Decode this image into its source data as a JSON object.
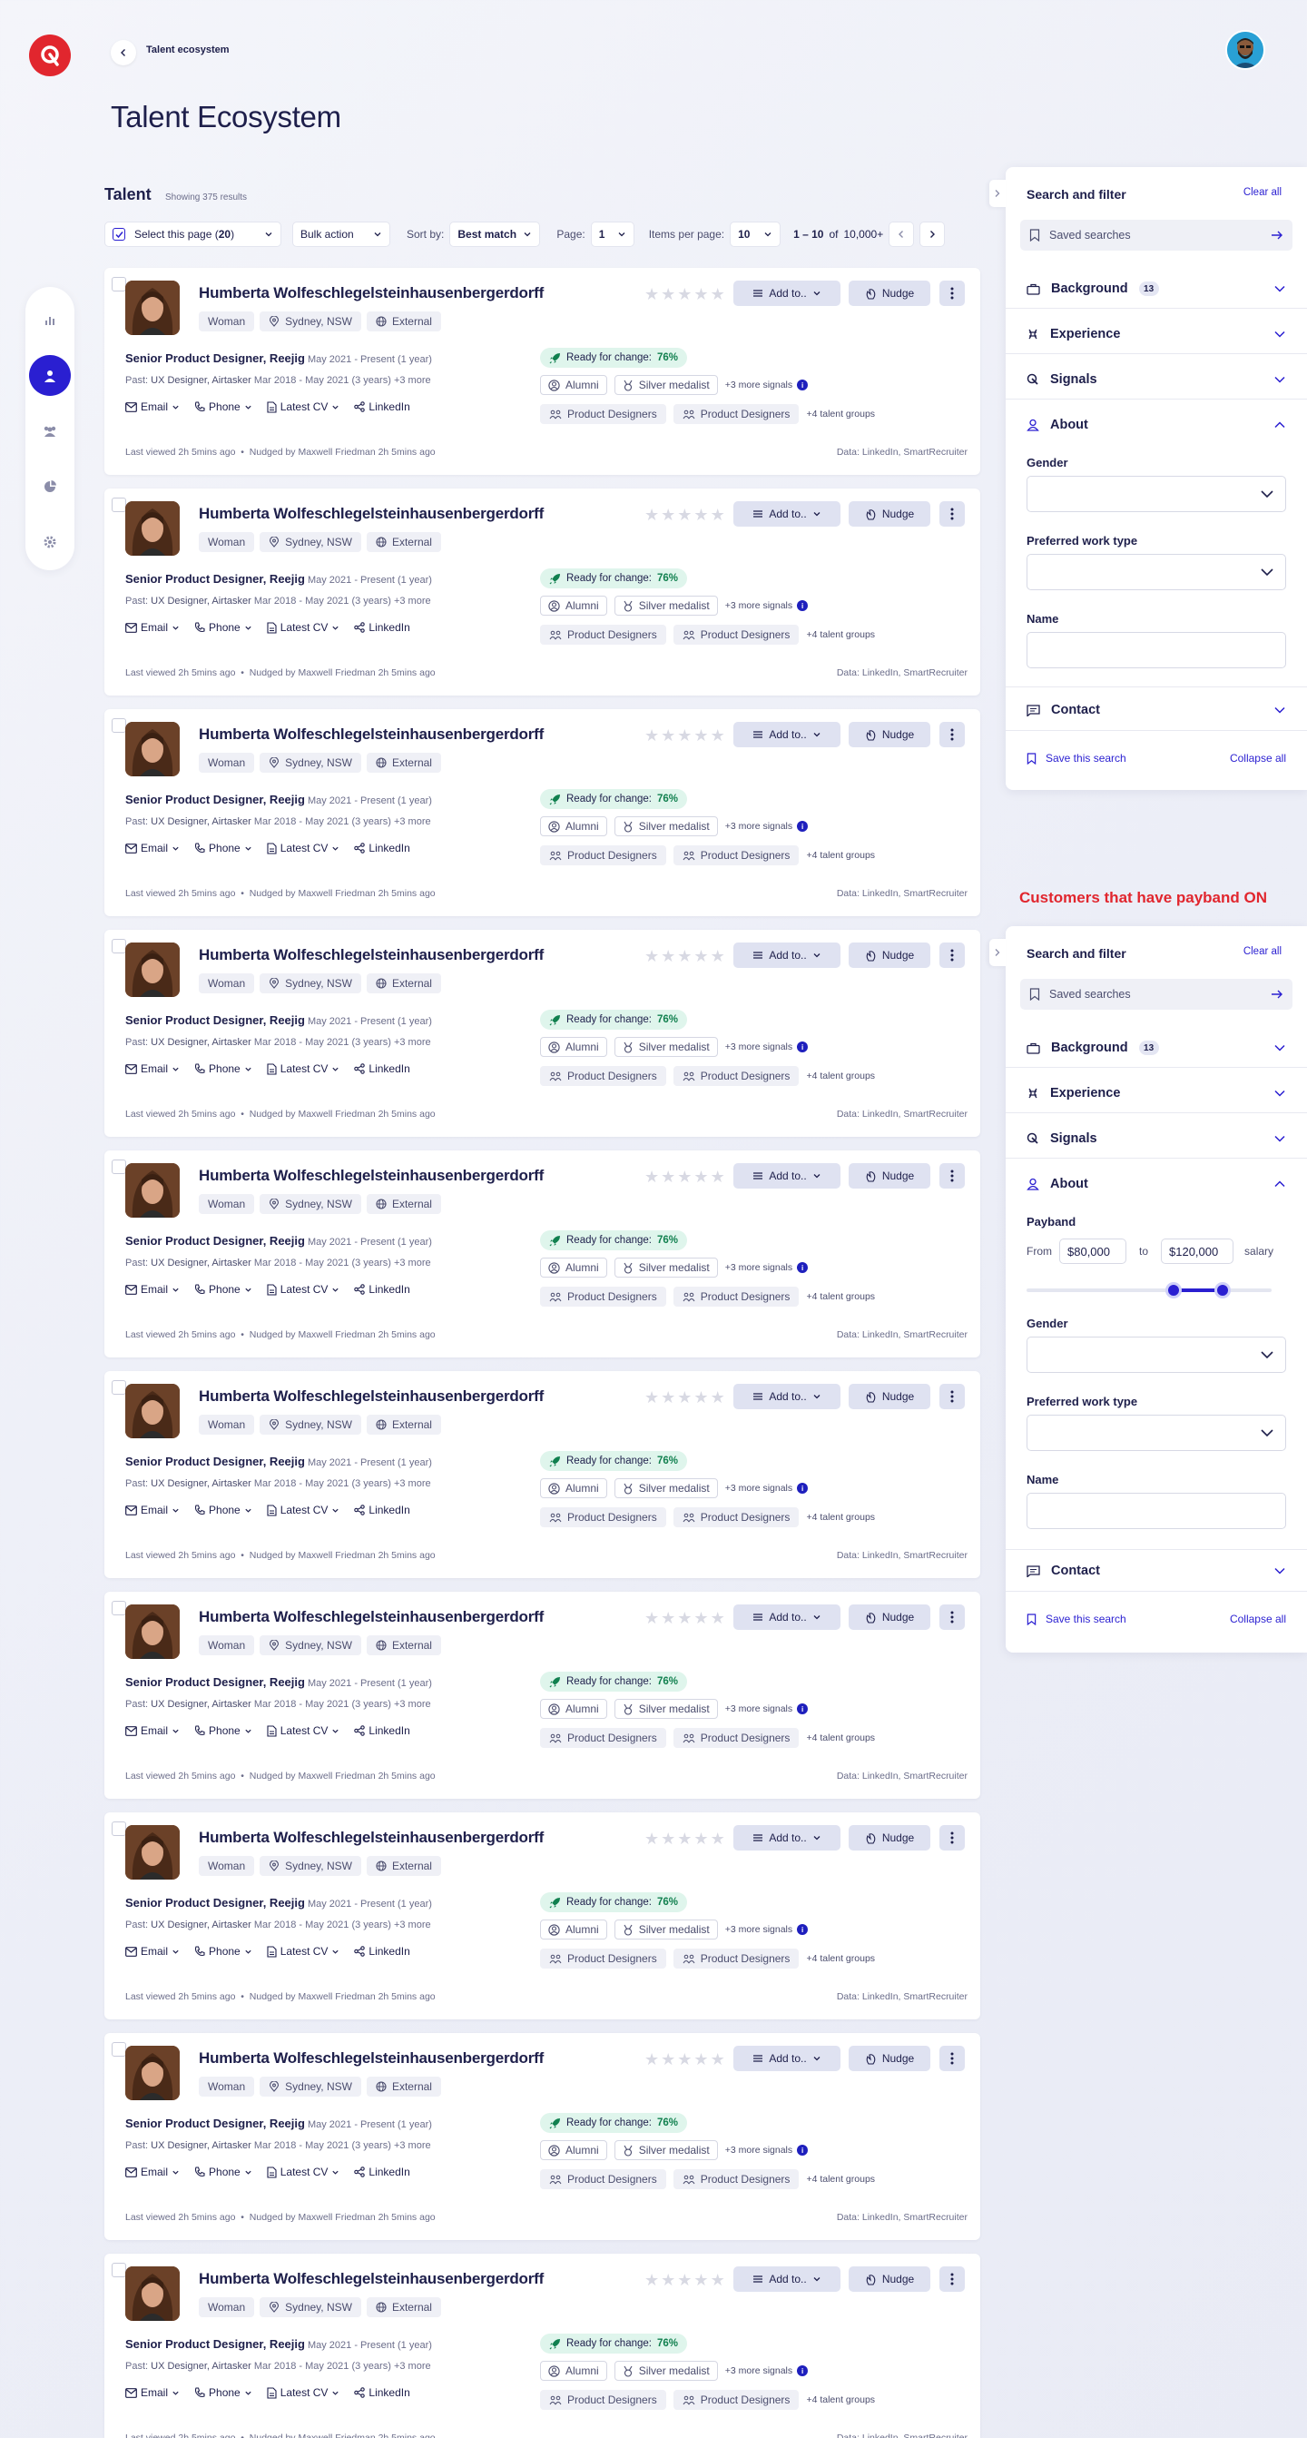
{
  "header": {
    "breadcrumb": "Talent ecosystem",
    "page_title": "Talent Ecosystem"
  },
  "nav": {
    "items": [
      "chart-icon",
      "person-icon",
      "group-icon",
      "pie-icon",
      "gear-icon"
    ],
    "active": 1
  },
  "list": {
    "title": "Talent",
    "showing": "Showing 375 results",
    "select_page_label": "Select this page (",
    "select_page_count": "20",
    "select_page_close": ")",
    "bulk_action": "Bulk action",
    "sort_by_label": "Sort by:",
    "sort_by_value": "Best match",
    "page_label": "Page:",
    "page_value": "1",
    "items_label": "Items per page:",
    "items_value": "10",
    "range": "1 – 10",
    "of": "of",
    "total": "10,000+"
  },
  "card": {
    "name": "Humberta Wolfeschlegelsteinhausenbergerdorff",
    "tags": [
      "Woman",
      "Sydney, NSW",
      "External"
    ],
    "add_to": "Add to..",
    "nudge": "Nudge",
    "role": "Senior Product Designer, Reejig",
    "role_dates": "May 2021 - Present (1 year)",
    "past_label": "Past:",
    "past_value": "UX Designer, Airtasker",
    "past_dates": "Mar 2018 - May 2021 (3 years)",
    "past_more": "+3 more",
    "links": [
      "Email",
      "Phone",
      "Latest CV",
      "LinkedIn"
    ],
    "ready_label": "Ready for change:",
    "ready_value": "76%",
    "signals": [
      "Alumni",
      "Silver medalist"
    ],
    "signals_more": "+3 more signals",
    "groups": [
      "Product Designers",
      "Product Designers"
    ],
    "groups_more": "+4 talent groups",
    "meta_viewed": "Last viewed 2h 5mins ago",
    "meta_nudged": "Nudged by Maxwell Friedman 2h 5mins ago",
    "source": "Data: LinkedIn, SmartRecruiter",
    "rating": 0,
    "count": 10
  },
  "filter": {
    "title": "Search and filter",
    "clear_all": "Clear all",
    "saved_searches": "Saved searches",
    "background": "Background",
    "background_count": "13",
    "experience": "Experience",
    "signals": "Signals",
    "about": "About",
    "gender": "Gender",
    "work_type": "Preferred work type",
    "name": "Name",
    "contact": "Contact",
    "save_search": "Save this search",
    "collapse_all": "Collapse all"
  },
  "payband_note": "Customers that have payband ON",
  "payband": {
    "label": "Payband",
    "from": "From",
    "from_value": "$80,000",
    "to": "to",
    "to_value": "$120,000",
    "unit": "salary",
    "range_low_fraction": 0.6,
    "range_high_fraction": 0.8
  },
  "colors": {
    "accent": "#2a1fd1",
    "brand": "#e1262e",
    "ready_bg": "#dff5ec",
    "ready_text": "#11804f"
  }
}
